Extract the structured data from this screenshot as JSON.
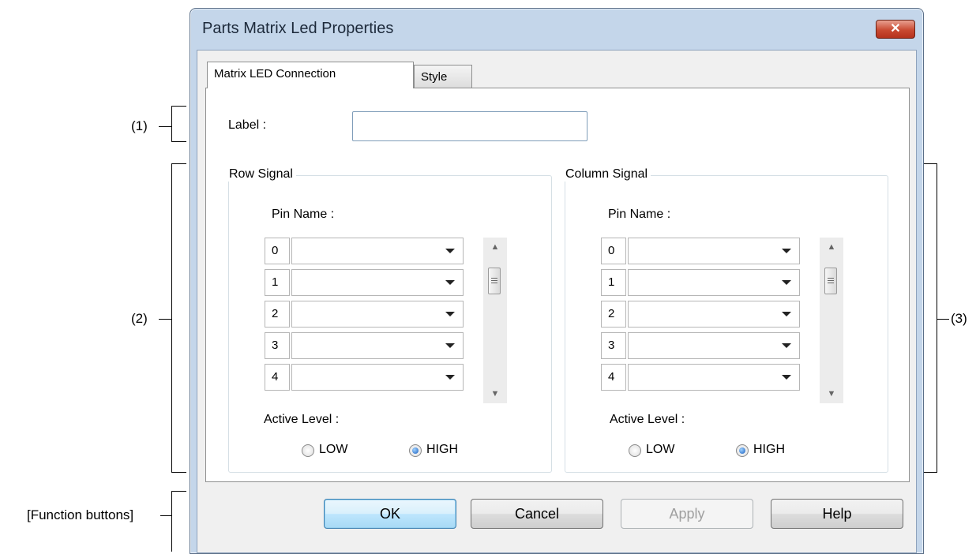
{
  "callouts": {
    "c1": "(1)",
    "c2": "(2)",
    "c3": "(3)",
    "function_buttons": "[Function buttons]"
  },
  "window": {
    "title": "Parts Matrix Led Properties",
    "close_glyph": "✕"
  },
  "tabs": [
    {
      "label": "Matrix LED Connection",
      "active": true
    },
    {
      "label": "Style",
      "active": false
    }
  ],
  "label_field": {
    "label": "Label :",
    "value": ""
  },
  "row_signal": {
    "title": "Row Signal",
    "pin_name_label": "Pin Name :",
    "pins": [
      "0",
      "1",
      "2",
      "3",
      "4"
    ],
    "active_level_label": "Active Level :",
    "options": [
      "LOW",
      "HIGH"
    ],
    "selected": "HIGH"
  },
  "column_signal": {
    "title": "Column Signal",
    "pin_name_label": "Pin Name :",
    "pins": [
      "0",
      "1",
      "2",
      "3",
      "4"
    ],
    "active_level_label": "Active Level :",
    "options": [
      "LOW",
      "HIGH"
    ],
    "selected": "HIGH"
  },
  "buttons": {
    "ok": "OK",
    "cancel": "Cancel",
    "apply": "Apply",
    "help": "Help"
  },
  "icons": {
    "dropdown": "chevron-down-icon",
    "close": "close-icon"
  },
  "colors": {
    "title_bar": "#c4d6ea",
    "close_button": "#c94a32",
    "radio_selected": "#1a5fbf"
  }
}
